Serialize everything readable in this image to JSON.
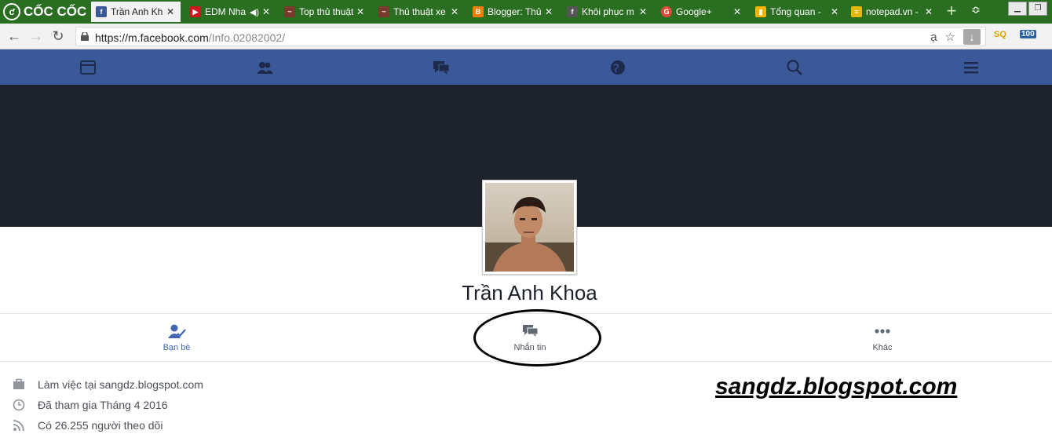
{
  "browser": {
    "brand": "CỐC CỐC",
    "tabs": [
      {
        "title": "Trần Anh Kh",
        "icon": "facebook-icon",
        "color": "#3b5998",
        "active": true
      },
      {
        "title": "EDM Nha",
        "icon": "youtube-icon",
        "color": "#cc181e",
        "audio": true
      },
      {
        "title": "Top thủ thuật",
        "icon": "blog-icon",
        "color": "#7a3b2e"
      },
      {
        "title": "Thủ thuật xe",
        "icon": "blog-icon",
        "color": "#7a3b2e"
      },
      {
        "title": "Blogger: Thủ",
        "icon": "blogger-icon",
        "color": "#f57d00"
      },
      {
        "title": "Khôi phục m",
        "icon": "facebook-icon",
        "color": "#555555"
      },
      {
        "title": "Google+",
        "icon": "google-plus-icon",
        "color": "#dd4b39"
      },
      {
        "title": "Tổng quan -",
        "icon": "analytics-icon",
        "color": "#f4b400"
      },
      {
        "title": "notepad.vn -",
        "icon": "notepad-icon",
        "color": "#e6b800"
      }
    ],
    "url_host": "https://m.facebook.com",
    "url_path": "/Info.02082002/",
    "translate_glyph": "ạ",
    "ext_sq": "SQ",
    "ext_100": "100"
  },
  "profile": {
    "name": "Trần Anh Khoa"
  },
  "actions": [
    {
      "label": "Bạn bè",
      "icon": "friends-check-icon"
    },
    {
      "label": "Nhắn tin",
      "icon": "message-icon"
    },
    {
      "label": "Khác",
      "icon": "more-icon"
    }
  ],
  "info": [
    {
      "text": "Làm việc tại sangdz.blogspot.com",
      "icon": "briefcase-icon"
    },
    {
      "text": "Đã tham gia Tháng 4 2016",
      "icon": "clock-icon"
    },
    {
      "text": "Có 26.255 người theo dõi",
      "icon": "rss-icon"
    }
  ],
  "watermark": "sangdz.blogspot.com",
  "colors": {
    "fb_blue": "#3b5998",
    "tabstrip": "#2a6e22",
    "cover": "#1e222d"
  }
}
